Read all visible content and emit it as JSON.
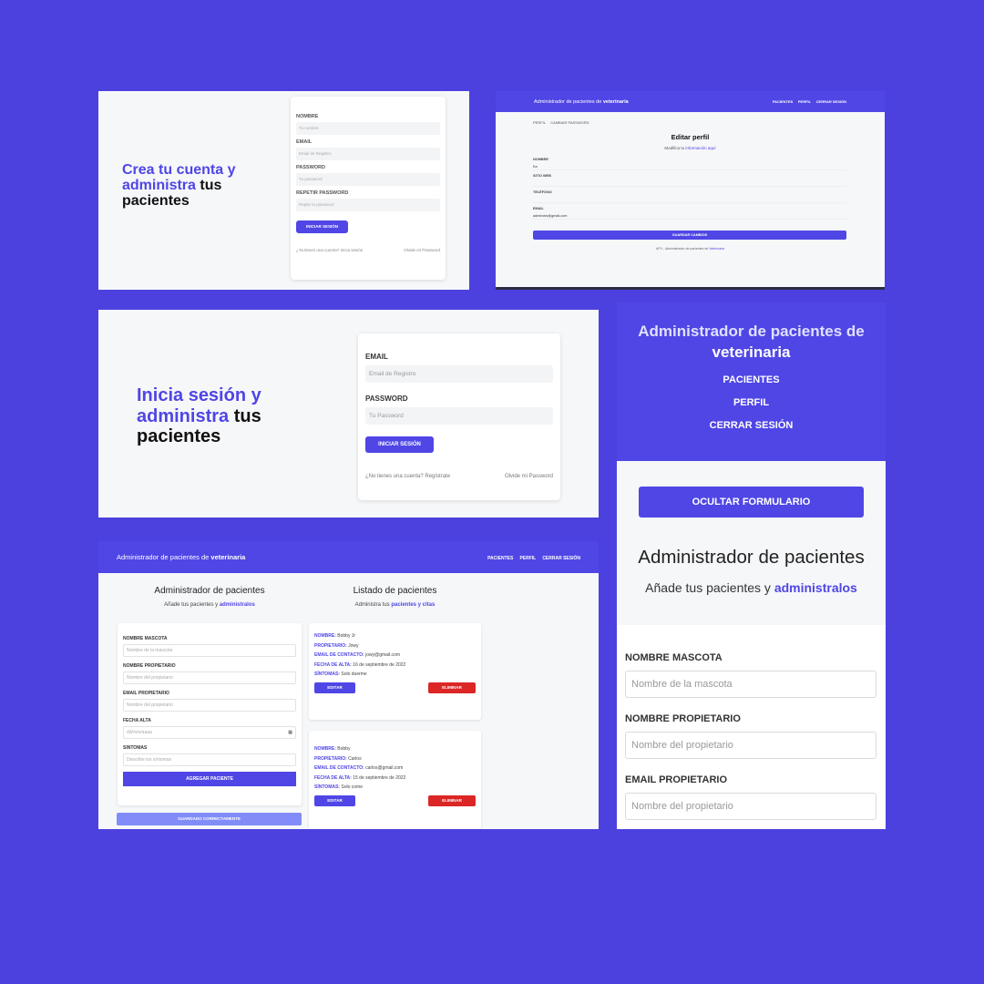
{
  "register": {
    "heading_1": "Crea tu cuenta y",
    "heading_2": "administra",
    "heading_3": "tus",
    "heading_4": "pacientes",
    "nombre_label": "NOMBRE",
    "nombre_placeholder": "Tu nombre",
    "email_label": "EMAIL",
    "email_placeholder": "Email de Registro",
    "password_label": "PASSWORD",
    "password_placeholder": "Tu password",
    "repeat_label": "REPETIR PASSWORD",
    "repeat_placeholder": "Repite tu password",
    "submit_label": "INICIAR SESIÓN",
    "login_link": "¿Ya tienes una cuenta? Inicia sesión",
    "forgot_link": "Olvide mi Password"
  },
  "profile": {
    "header_title": "Administrador de pacientes de",
    "header_brand": "veterinaria",
    "nav": [
      "PACIENTES",
      "PERFIL",
      "CERRAR SESIÓN"
    ],
    "subnav": [
      "PERFIL",
      "CAMBIAR PASSWORD"
    ],
    "title": "Editar perfil",
    "subtitle": "Modifica tu",
    "subtitle_link": "información aquí",
    "fields": [
      {
        "label": "NOMBRE",
        "value": "Ka"
      },
      {
        "label": "SITIO WEB",
        "value": ""
      },
      {
        "label": "TELÉFONO",
        "value": ""
      },
      {
        "label": "EMAIL",
        "value": "admindvs@gmail.com"
      }
    ],
    "save_label": "GUARDAR CAMBIOS",
    "footer": "APV - Administrador de pacientes de",
    "footer_link": "Veterinaria"
  },
  "login": {
    "heading_1": "Inicia sesión y",
    "heading_2": "administra",
    "heading_3": "tus",
    "heading_4": "pacientes",
    "email_label": "EMAIL",
    "email_placeholder": "Email de Registro",
    "password_label": "PASSWORD",
    "password_placeholder": "Tu Password",
    "submit_label": "INICIAR SESIÓN",
    "register_link": "¿No tienes una cuenta? Regístrate",
    "forgot_link": "Olvide mi Password"
  },
  "mobile": {
    "title": "Administrador de pacientes de",
    "brand": "veterinaria",
    "nav": [
      "PACIENTES",
      "PERFIL",
      "CERRAR SESIÓN"
    ],
    "hide_button": "OCULTAR FORMULARIO",
    "main_title": "Administrador de pacientes",
    "main_sub": "Añade tus pacientes y",
    "main_sub_link": "administralos",
    "fields": [
      {
        "label": "NOMBRE MASCOTA",
        "placeholder": "Nombre de la mascota"
      },
      {
        "label": "NOMBRE PROPIETARIO",
        "placeholder": "Nombre del propietario"
      },
      {
        "label": "EMAIL PROPIETARIO",
        "placeholder": "Nombre del propietario"
      }
    ]
  },
  "dashboard": {
    "header_title": "Administrador de pacientes de",
    "header_brand": "veterinaria",
    "nav": [
      "PACIENTES",
      "PERFIL",
      "CERRAR SESIÓN"
    ],
    "left_title": "Administrador de pacientes",
    "left_sub": "Añade tus pacientes y",
    "left_sub_link": "administralos",
    "right_title": "Listado de pacientes",
    "right_sub": "Administra tus",
    "right_sub_link": "pacientes y citas",
    "form_fields": [
      {
        "label": "NOMBRE MASCOTA",
        "placeholder": "Nombre de la mascota"
      },
      {
        "label": "NOMBRE PROPIETARIO",
        "placeholder": "Nombre del propietario"
      },
      {
        "label": "EMAIL PROPIETARIO",
        "placeholder": "Nombre del propietario"
      },
      {
        "label": "FECHA ALTA",
        "placeholder": "dd/mm/aaaa"
      },
      {
        "label": "SINTOMAS",
        "placeholder": "Describe los síntomas"
      }
    ],
    "add_button": "AGREGAR PACIENTE",
    "success_message": "GUARDADO CORRECTAMENTE",
    "patient_labels": {
      "nombre": "NOMBRE:",
      "propietario": "PROPIETARIO:",
      "email": "EMAIL DE CONTACTO:",
      "fecha": "FECHA DE ALTA:",
      "sintomas": "SÍNTOMAS:"
    },
    "patients": [
      {
        "nombre": "Bobby Jr",
        "propietario": "Jowy",
        "email": "jowy@gmail.com",
        "fecha": "16 de septiembre de 2022",
        "sintomas": "Solo duerme"
      },
      {
        "nombre": "Bobby",
        "propietario": "Carlos",
        "email": "carlos@gmail.com",
        "fecha": "15 de septiembre de 2022",
        "sintomas": "Solo come"
      }
    ],
    "edit_label": "EDITAR",
    "delete_label": "ELIMINAR"
  }
}
